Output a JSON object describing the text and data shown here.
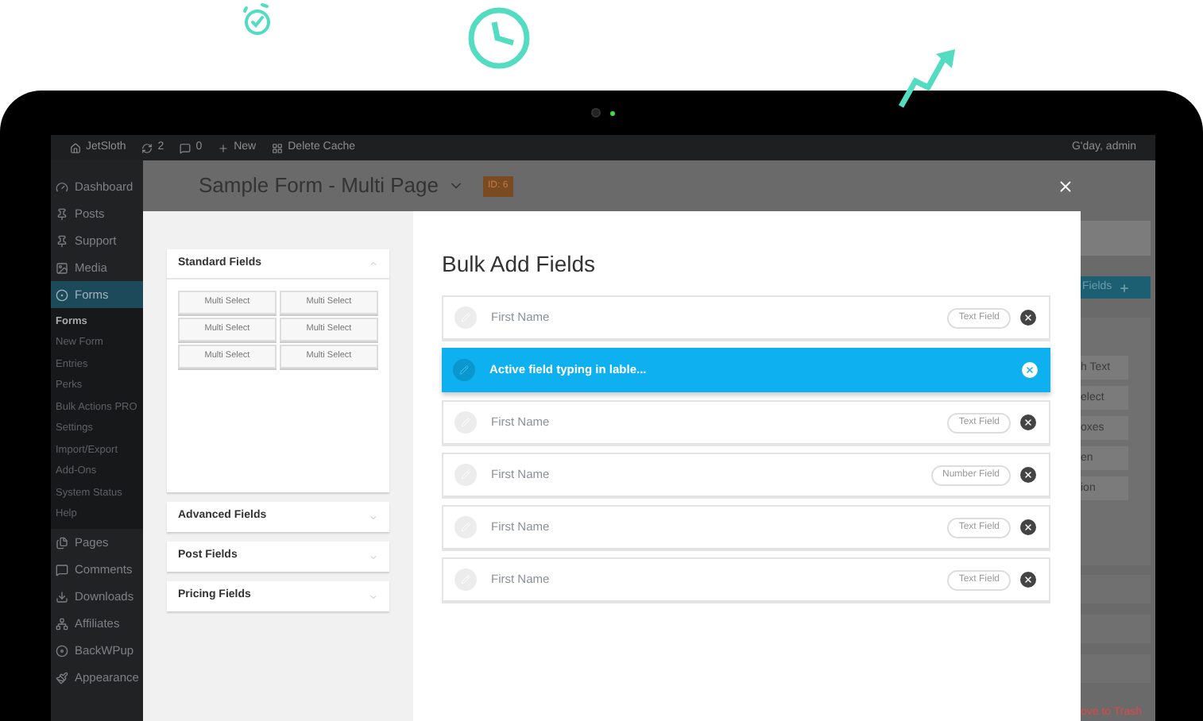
{
  "admin_bar": {
    "items": [
      {
        "kind": "home",
        "label": "JetSloth"
      },
      {
        "kind": "refresh",
        "label": "2"
      },
      {
        "kind": "comment",
        "label": "0"
      },
      {
        "kind": "plus",
        "label": "New"
      },
      {
        "kind": "plugin",
        "label": "Delete Cache"
      }
    ],
    "greeting": "G'day, admin"
  },
  "sidebar": {
    "items": [
      {
        "kind": "dashboard",
        "label": "Dashboard",
        "selected": false
      },
      {
        "kind": "pin",
        "label": "Posts",
        "selected": false
      },
      {
        "kind": "pin",
        "label": "Support",
        "selected": false
      },
      {
        "kind": "media",
        "label": "Media",
        "selected": false
      },
      {
        "kind": "forms",
        "label": "Forms",
        "selected": true,
        "children": [
          {
            "label": "Forms",
            "selected": true
          },
          {
            "label": "New Form",
            "selected": false
          },
          {
            "label": "Entries",
            "selected": false
          },
          {
            "label": "Perks",
            "selected": false
          },
          {
            "label": "Bulk Actions PRO",
            "selected": false
          },
          {
            "label": "Settings",
            "selected": false
          },
          {
            "label": "Import/Export",
            "selected": false
          },
          {
            "label": "Add-Ons",
            "selected": false
          },
          {
            "label": "System Status",
            "selected": false
          },
          {
            "label": "Help",
            "selected": false
          }
        ]
      },
      {
        "kind": "pages",
        "label": "Pages",
        "selected": false
      },
      {
        "kind": "comment",
        "label": "Comments",
        "selected": false
      },
      {
        "kind": "download",
        "label": "Downloads",
        "selected": false
      },
      {
        "kind": "affiliates",
        "label": "Affiliates",
        "selected": false
      },
      {
        "kind": "backup",
        "label": "BackWPup",
        "selected": false
      },
      {
        "kind": "brush",
        "label": "Appearance",
        "selected": false
      }
    ]
  },
  "page": {
    "title": "Sample Form - Multi Page",
    "badge": "ID: 6",
    "add_button": "Fields",
    "list_items": [
      "h Text",
      "elect",
      "oxes",
      "en",
      "ion"
    ],
    "trash_link": "ove to Trash"
  },
  "modal": {
    "palette": [
      {
        "title": "Standard Fields",
        "expanded": true,
        "buttons": [
          "Multi Select",
          "Multi Select",
          "Multi Select",
          "Multi Select",
          "Multi Select",
          "Multi Select"
        ]
      },
      {
        "title": "Advanced Fields",
        "expanded": false
      },
      {
        "title": "Post Fields",
        "expanded": false
      },
      {
        "title": "Pricing Fields",
        "expanded": false
      }
    ],
    "heading": "Bulk Add Fields",
    "fields": [
      {
        "label": "First Name",
        "type": "Text Field",
        "selected": false
      },
      {
        "label": "Active field typing in lable...",
        "selected": true
      },
      {
        "label": "First Name",
        "type": "Text Field",
        "selected": false
      },
      {
        "label": "First Name",
        "type": "Number Field",
        "selected": false
      },
      {
        "label": "First Name",
        "type": "Text Field",
        "selected": false
      },
      {
        "label": "First Name",
        "type": "Text Field",
        "selected": false
      }
    ]
  }
}
